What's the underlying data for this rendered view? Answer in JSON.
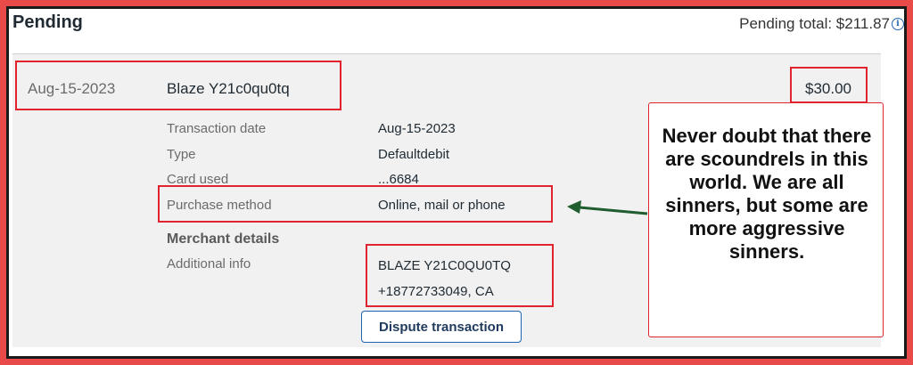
{
  "section": {
    "title": "Pending",
    "total_label": "Pending total: $211.87",
    "info_icon": "i"
  },
  "transaction": {
    "date": "Aug-15-2023",
    "merchant": "Blaze Y21c0qu0tq",
    "amount": "$30.00"
  },
  "details": [
    {
      "label": "Transaction date",
      "value": "Aug-15-2023"
    },
    {
      "label": "Type",
      "value": "Defaultdebit"
    },
    {
      "label": "Card used",
      "value": "...6684"
    },
    {
      "label": "Purchase method",
      "value": "Online, mail or phone"
    }
  ],
  "merchant_details": {
    "heading": "Merchant details",
    "label": "Additional info",
    "line1": "BLAZE Y21C0QU0TQ",
    "line2": "+18772733049, CA"
  },
  "dispute_button": "Dispute transaction",
  "annotation": {
    "text": "Never doubt that there are scoundrels in this world. We are all sinners, but some are more aggressive sinners.",
    "highlight_color": "#e0232e",
    "arrow_color": "#1f5c2e"
  },
  "colors": {
    "frame": "#e84a4a",
    "link_blue": "#1f64b0"
  }
}
